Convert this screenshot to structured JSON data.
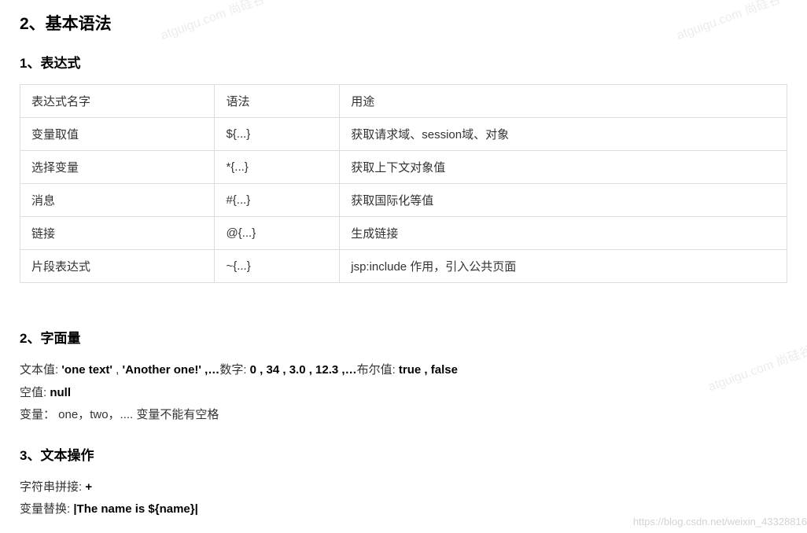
{
  "watermarks": {
    "top": "atguigu.com 尚硅谷",
    "bottom": "https://blog.csdn.net/weixin_43328816"
  },
  "headings": {
    "main": "2、基本语法",
    "sub1": "1、表达式",
    "sub2": "2、字面量",
    "sub3": "3、文本操作"
  },
  "table": {
    "headers": [
      "表达式名字",
      "语法",
      "用途"
    ],
    "rows": [
      [
        "变量取值",
        "${...}",
        "获取请求域、session域、对象"
      ],
      [
        "选择变量",
        "*{...}",
        "获取上下文对象值"
      ],
      [
        "消息",
        "#{...}",
        "获取国际化等值"
      ],
      [
        "链接",
        "@{...}",
        "生成链接"
      ],
      [
        "片段表达式",
        "~{...}",
        "jsp:include 作用，引入公共页面"
      ]
    ]
  },
  "literals": {
    "line1_prefix": "文本值: ",
    "line1_val1": "'one text'",
    "line1_sep1": " , ",
    "line1_val2": "'Another one!' ,…",
    "line1_num_label": "数字: ",
    "line1_nums": "0 , 34 , 3.0 , 12.3 ,…",
    "line1_bool_label": "布尔值: ",
    "line1_bools": "true , false",
    "line2_prefix": "空值: ",
    "line2_val": "null",
    "line3": "变量：  one，two，.... 变量不能有空格"
  },
  "textops": {
    "line1_prefix": "字符串拼接: ",
    "line1_val": "+",
    "line2_prefix": "变量替换: ",
    "line2_val": "|The name is ${name}|"
  }
}
